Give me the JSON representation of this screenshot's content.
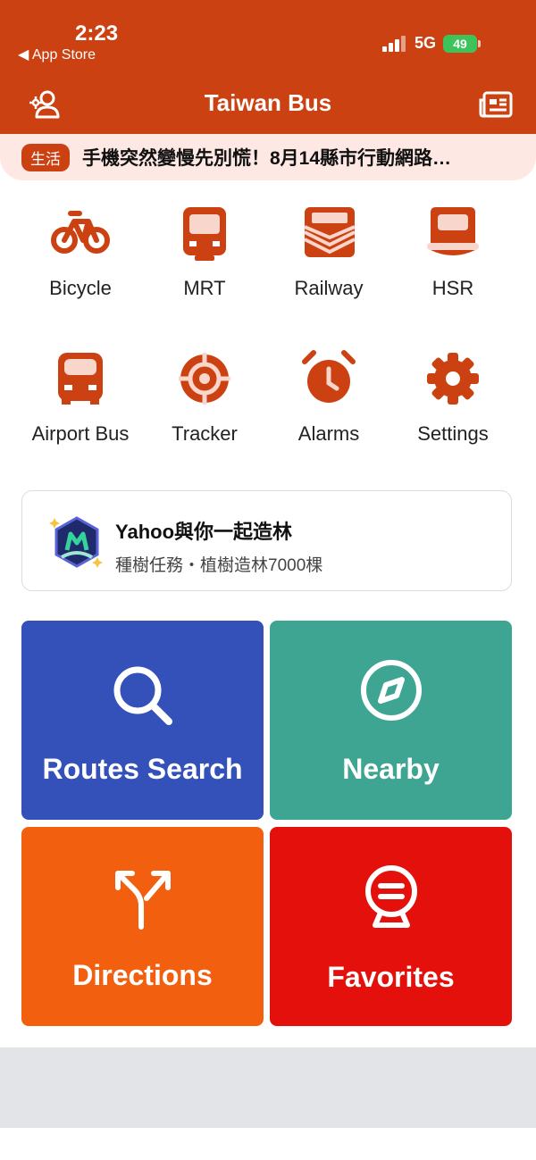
{
  "status_bar": {
    "time": "2:23",
    "back_label": "◀ App Store",
    "network": "5G",
    "battery": "49"
  },
  "header": {
    "title": "Taiwan Bus",
    "left_icon": "user-settings-icon",
    "right_icon": "news-icon"
  },
  "ticker": {
    "tag": "生活",
    "text": "手機突然變慢先別慌！8月14縣市行動網路…"
  },
  "transport_modes": [
    {
      "label": "Bicycle",
      "icon": "bicycle-icon"
    },
    {
      "label": "MRT",
      "icon": "mrt-icon"
    },
    {
      "label": "Railway",
      "icon": "railway-icon"
    },
    {
      "label": "HSR",
      "icon": "hsr-icon"
    },
    {
      "label": "Airport Bus",
      "icon": "airport-bus-icon"
    },
    {
      "label": "Tracker",
      "icon": "tracker-icon"
    },
    {
      "label": "Alarms",
      "icon": "alarm-icon"
    },
    {
      "label": "Settings",
      "icon": "gear-icon"
    }
  ],
  "promo": {
    "title": "Yahoo與你一起造林",
    "subtitle": "種樹任務・植樹造林7000棵",
    "icon": "forest-badge-icon"
  },
  "tiles": [
    {
      "label": "Routes Search",
      "icon": "search-icon",
      "color": "#3450b9"
    },
    {
      "label": "Nearby",
      "icon": "compass-icon",
      "color": "#3ea592"
    },
    {
      "label": "Directions",
      "icon": "directions-icon",
      "color": "#f2600f"
    },
    {
      "label": "Favorites",
      "icon": "favorites-icon",
      "color": "#e4100c"
    }
  ],
  "colors": {
    "brand": "#cc4112",
    "ticker_bg": "#fde8e4",
    "footer": "#e3e4e8"
  }
}
